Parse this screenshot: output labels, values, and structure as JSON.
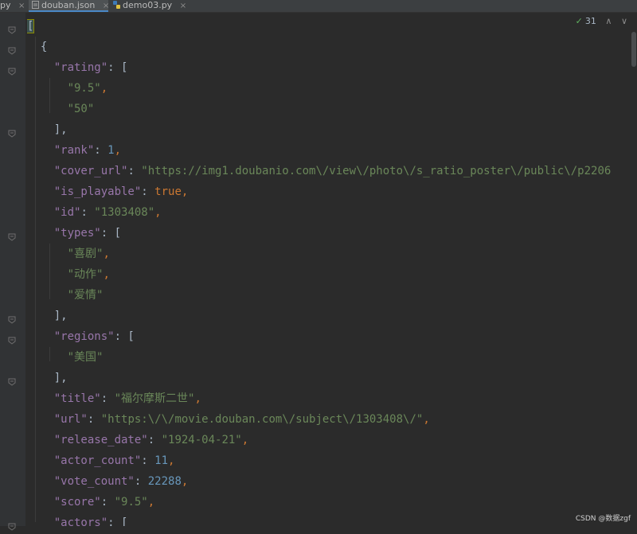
{
  "tabs": [
    {
      "label": "py",
      "active": false,
      "close": "×"
    },
    {
      "label": "douban.json",
      "active": true,
      "close": "×"
    },
    {
      "label": "demo03.py",
      "active": false,
      "close": "×"
    }
  ],
  "inspection": {
    "count": "31",
    "up": "∧",
    "down": "∨"
  },
  "code_lines": [
    [
      {
        "t": "[",
        "c": "p"
      }
    ],
    [
      {
        "t": "  {",
        "c": "p"
      }
    ],
    [
      {
        "t": "    ",
        "c": "p"
      },
      {
        "t": "\"rating\"",
        "c": "k"
      },
      {
        "t": ": [",
        "c": "p"
      }
    ],
    [
      {
        "t": "      ",
        "c": "p"
      },
      {
        "t": "\"9.5\"",
        "c": "s"
      },
      {
        "t": ",",
        "c": "b"
      }
    ],
    [
      {
        "t": "      ",
        "c": "p"
      },
      {
        "t": "\"50\"",
        "c": "s"
      }
    ],
    [
      {
        "t": "    ],",
        "c": "p"
      }
    ],
    [
      {
        "t": "    ",
        "c": "p"
      },
      {
        "t": "\"rank\"",
        "c": "k"
      },
      {
        "t": ": ",
        "c": "p"
      },
      {
        "t": "1",
        "c": "n"
      },
      {
        "t": ",",
        "c": "b"
      }
    ],
    [
      {
        "t": "    ",
        "c": "p"
      },
      {
        "t": "\"cover_url\"",
        "c": "k"
      },
      {
        "t": ": ",
        "c": "p"
      },
      {
        "t": "\"https://img1.doubanio.com\\/view\\/photo\\/s_ratio_poster\\/public\\/p2206",
        "c": "s"
      }
    ],
    [
      {
        "t": "    ",
        "c": "p"
      },
      {
        "t": "\"is_playable\"",
        "c": "k"
      },
      {
        "t": ": ",
        "c": "p"
      },
      {
        "t": "true",
        "c": "b"
      },
      {
        "t": ",",
        "c": "b"
      }
    ],
    [
      {
        "t": "    ",
        "c": "p"
      },
      {
        "t": "\"id\"",
        "c": "k"
      },
      {
        "t": ": ",
        "c": "p"
      },
      {
        "t": "\"1303408\"",
        "c": "s"
      },
      {
        "t": ",",
        "c": "b"
      }
    ],
    [
      {
        "t": "    ",
        "c": "p"
      },
      {
        "t": "\"types\"",
        "c": "k"
      },
      {
        "t": ": [",
        "c": "p"
      }
    ],
    [
      {
        "t": "      ",
        "c": "p"
      },
      {
        "t": "\"喜剧\"",
        "c": "s"
      },
      {
        "t": ",",
        "c": "b"
      }
    ],
    [
      {
        "t": "      ",
        "c": "p"
      },
      {
        "t": "\"动作\"",
        "c": "s"
      },
      {
        "t": ",",
        "c": "b"
      }
    ],
    [
      {
        "t": "      ",
        "c": "p"
      },
      {
        "t": "\"爱情\"",
        "c": "s"
      }
    ],
    [
      {
        "t": "    ],",
        "c": "p"
      }
    ],
    [
      {
        "t": "    ",
        "c": "p"
      },
      {
        "t": "\"regions\"",
        "c": "k"
      },
      {
        "t": ": [",
        "c": "p"
      }
    ],
    [
      {
        "t": "      ",
        "c": "p"
      },
      {
        "t": "\"美国\"",
        "c": "s"
      }
    ],
    [
      {
        "t": "    ],",
        "c": "p"
      }
    ],
    [
      {
        "t": "    ",
        "c": "p"
      },
      {
        "t": "\"title\"",
        "c": "k"
      },
      {
        "t": ": ",
        "c": "p"
      },
      {
        "t": "\"福尔摩斯二世\"",
        "c": "s"
      },
      {
        "t": ",",
        "c": "b"
      }
    ],
    [
      {
        "t": "    ",
        "c": "p"
      },
      {
        "t": "\"url\"",
        "c": "k"
      },
      {
        "t": ": ",
        "c": "p"
      },
      {
        "t": "\"https:\\/\\/movie.douban.com\\/subject\\/1303408\\/\"",
        "c": "s"
      },
      {
        "t": ",",
        "c": "b"
      }
    ],
    [
      {
        "t": "    ",
        "c": "p"
      },
      {
        "t": "\"release_date\"",
        "c": "k"
      },
      {
        "t": ": ",
        "c": "p"
      },
      {
        "t": "\"1924-04-21\"",
        "c": "s"
      },
      {
        "t": ",",
        "c": "b"
      }
    ],
    [
      {
        "t": "    ",
        "c": "p"
      },
      {
        "t": "\"actor_count\"",
        "c": "k"
      },
      {
        "t": ": ",
        "c": "p"
      },
      {
        "t": "11",
        "c": "n"
      },
      {
        "t": ",",
        "c": "b"
      }
    ],
    [
      {
        "t": "    ",
        "c": "p"
      },
      {
        "t": "\"vote_count\"",
        "c": "k"
      },
      {
        "t": ": ",
        "c": "p"
      },
      {
        "t": "22288",
        "c": "n"
      },
      {
        "t": ",",
        "c": "b"
      }
    ],
    [
      {
        "t": "    ",
        "c": "p"
      },
      {
        "t": "\"score\"",
        "c": "k"
      },
      {
        "t": ": ",
        "c": "p"
      },
      {
        "t": "\"9.5\"",
        "c": "s"
      },
      {
        "t": ",",
        "c": "b"
      }
    ],
    [
      {
        "t": "    ",
        "c": "p"
      },
      {
        "t": "\"actors\"",
        "c": "k"
      },
      {
        "t": ": [",
        "c": "p"
      }
    ]
  ],
  "fold_marker_lines": [
    0,
    1,
    2,
    5,
    10,
    14,
    15,
    17,
    24
  ],
  "watermark": "CSDN @数据zgf",
  "colors": {
    "background": "#2b2b2b",
    "key": "#9876aa",
    "string": "#6a8759",
    "number": "#6897bb",
    "keyword": "#cc7832"
  }
}
